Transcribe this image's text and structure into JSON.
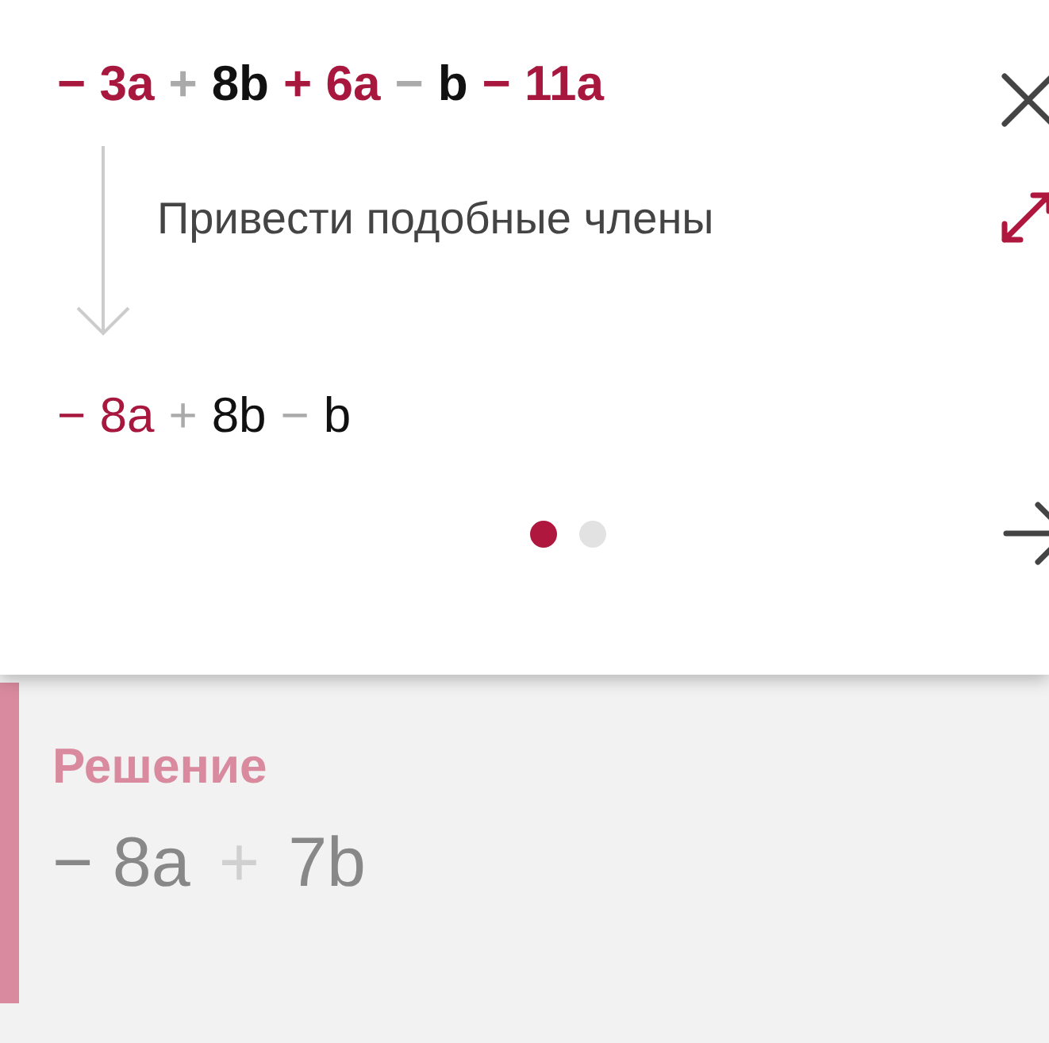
{
  "step": {
    "expression": [
      {
        "text": "− 3a",
        "kind": "highlight"
      },
      {
        "text": "+",
        "kind": "op"
      },
      {
        "text": "8b",
        "kind": "term"
      },
      {
        "text": "+ 6a",
        "kind": "highlight"
      },
      {
        "text": "−",
        "kind": "op"
      },
      {
        "text": "b",
        "kind": "term"
      },
      {
        "text": "− 11a",
        "kind": "highlight"
      }
    ],
    "hint": "Привести подобные члены",
    "result": [
      {
        "text": "− 8a",
        "kind": "highlight"
      },
      {
        "text": "+",
        "kind": "op"
      },
      {
        "text": "8b",
        "kind": "term"
      },
      {
        "text": "−",
        "kind": "op"
      },
      {
        "text": "b",
        "kind": "term"
      }
    ],
    "pages": [
      {
        "selected": true
      },
      {
        "selected": false
      }
    ]
  },
  "solution": {
    "title": "Решение",
    "answer": [
      {
        "text": "− 8a",
        "kind": "term"
      },
      {
        "text": "+",
        "kind": "op"
      },
      {
        "text": "7b",
        "kind": "term"
      }
    ]
  }
}
